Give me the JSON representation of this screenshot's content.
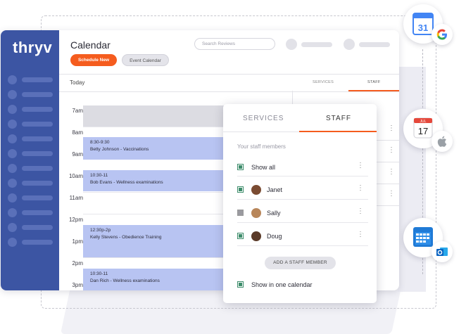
{
  "brand": {
    "logo": "thryv",
    "accent": "#f55c1e",
    "sidebar_color": "#3c55a3"
  },
  "header": {
    "title": "Calendar",
    "schedule_new": "Schedule New",
    "event_calendar": "Event Calendar",
    "search_placeholder": "Search Reviews"
  },
  "subbar": {
    "today": "Today",
    "tab_services": "SERVICES",
    "tab_staff": "STAFF"
  },
  "times": [
    "7am",
    "8am",
    "9am",
    "10am",
    "11am",
    "12pm",
    "1pm",
    "2pm",
    "3pm"
  ],
  "appointments": [
    {
      "time": "8:30-9:30",
      "desc": "Betty Johnson - Vaccinations"
    },
    {
      "time": "10:30-11",
      "desc": "Bob Evans - Wellness examinations"
    },
    {
      "time": "12:30p-2p",
      "desc": "Kelly Stevens - Obedience Training"
    },
    {
      "time": "10:30-11",
      "desc": "Dan Rich - Wellness examinations"
    }
  ],
  "popup": {
    "tab_services": "SERVICES",
    "tab_staff": "STAFF",
    "your_staff": "Your staff members",
    "rows": [
      {
        "label": "Show all",
        "checked": true
      },
      {
        "label": "Janet",
        "checked": true
      },
      {
        "label": "Sally",
        "checked": false
      },
      {
        "label": "Doug",
        "checked": true
      }
    ],
    "add_button": "ADD A STAFF MEMBER",
    "one_calendar": "Show in one calendar"
  },
  "integrations": {
    "google_calendar_day": "31",
    "apple_calendar_month": "JUL",
    "apple_calendar_day": "17",
    "icons": [
      "google-calendar-icon",
      "google-icon",
      "apple-calendar-icon",
      "apple-icon",
      "outlook-calendar-icon",
      "outlook-icon"
    ]
  }
}
